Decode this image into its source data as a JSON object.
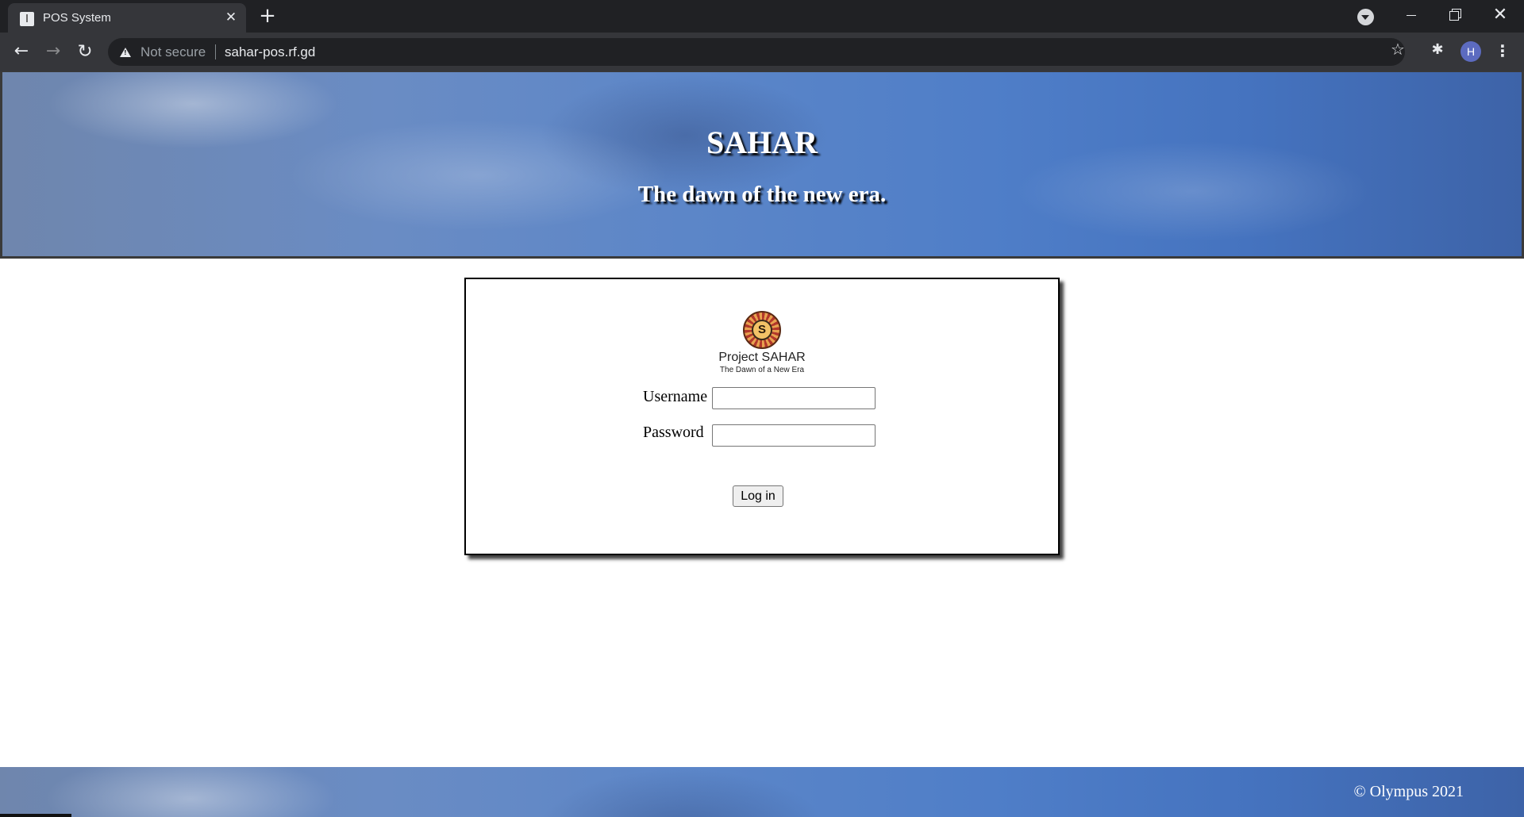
{
  "browser": {
    "tab_title": "POS System",
    "address_warning": "Not secure",
    "url": "sahar-pos.rf.gd",
    "profile_initial": "H",
    "icons": {
      "back": "arrow-left",
      "forward": "arrow-right",
      "reload": "reload",
      "bookmark": "star",
      "extensions": "puzzle",
      "menu": "kebab"
    }
  },
  "header": {
    "title": "SAHAR",
    "subtitle": "The dawn of the new era."
  },
  "login": {
    "logo": {
      "emblem_letter": "S",
      "name": "Project SAHAR",
      "tagline": "The Dawn of a New Era"
    },
    "username_label": "Username",
    "username_value": "",
    "password_label": "Password",
    "password_value": "",
    "submit_label": "Log in"
  },
  "footer": {
    "copyright": "© Olympus 2021"
  },
  "colors": {
    "chrome_dark": "#202124",
    "chrome_toolbar": "#35363a",
    "sky_blue": "#4f7ec8",
    "avatar": "#5c6bc0"
  }
}
